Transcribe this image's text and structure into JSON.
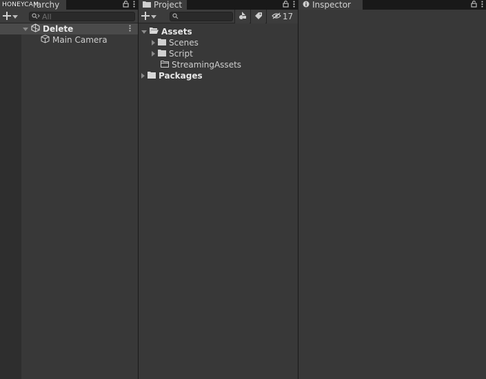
{
  "watermark": "HONEYCAM",
  "hierarchy": {
    "tab_label": "rarchy",
    "search_placeholder": "All",
    "scene": "Delete",
    "items": [
      "Main Camera"
    ]
  },
  "project": {
    "tab_label": "Project",
    "hidden_count": "17",
    "tree": {
      "assets": "Assets",
      "children": [
        "Scenes",
        "Script",
        "StreamingAssets"
      ],
      "packages": "Packages"
    }
  },
  "inspector": {
    "tab_label": "Inspector"
  }
}
